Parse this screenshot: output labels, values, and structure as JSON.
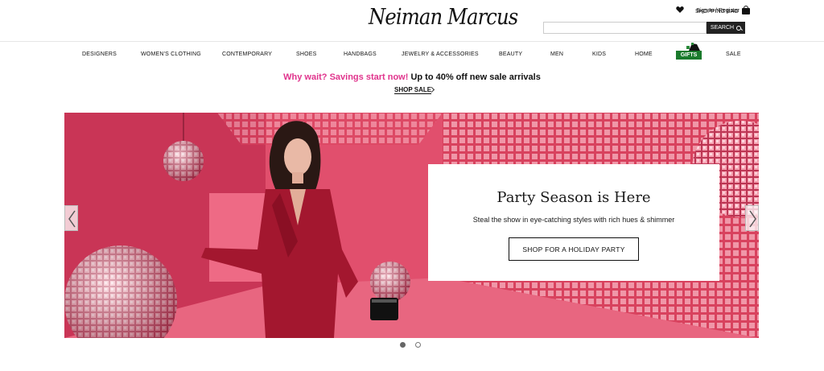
{
  "header": {
    "logo": "Neiman Marcus",
    "sign_in": "Sign In / Register",
    "shopping_bag": "SHOPPING BAG",
    "search_placeholder": "",
    "search_button": "SEARCH"
  },
  "nav": {
    "items": [
      {
        "label": "DESIGNERS"
      },
      {
        "label": "WOMEN'S CLOTHING"
      },
      {
        "label": "CONTEMPORARY"
      },
      {
        "label": "SHOES"
      },
      {
        "label": "HANDBAGS"
      },
      {
        "label": "JEWELRY & ACCESSORIES"
      },
      {
        "label": "BEAUTY"
      },
      {
        "label": "MEN"
      },
      {
        "label": "KIDS"
      },
      {
        "label": "HOME"
      },
      {
        "label": "GIFTS"
      },
      {
        "label": "SALE"
      }
    ]
  },
  "promo": {
    "highlight": "Why wait? Savings start now!",
    "text": "Up to 40% off new sale arrivals",
    "link": "SHOP SALE"
  },
  "hero": {
    "title": "Party Season is Here",
    "subtitle": "Steal the show in eye-catching styles with rich hues & shimmer",
    "cta": "SHOP FOR A HOLIDAY PARTY",
    "slides": 2,
    "active_slide": 1
  },
  "colors": {
    "promo_pink": "#e0338c",
    "gifts_green": "#1a7a2c",
    "hero_red": "#d8385b"
  }
}
